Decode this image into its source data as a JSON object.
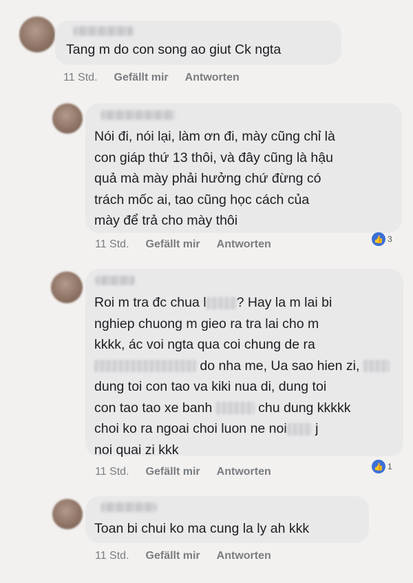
{
  "comments": [
    {
      "text": "Tang m do con song ao giut Ck ngta",
      "time": "11 Std.",
      "like": "Gefällt mir",
      "reply": "Antworten"
    },
    {
      "text": "Nói đi, nói lại, làm ơn đi, mày cũng chỉ là\ncon giáp thứ 13 thôi, và đây cũng là hậu\nquả mà mày phải hưởng chứ đừng có\ntrách mốc ai, tao cũng học cách của\nmày để trả cho mày thôi",
      "time": "11 Std.",
      "like": "Gefällt mir",
      "reply": "Antworten",
      "reaction_count": "3"
    },
    {
      "line1a": "Roi m tra đc chua l",
      "line1b": "? Hay la m lai bi",
      "line2": "nghiep chuong m gieo ra tra lai cho m",
      "line3": "kkkk, ác voi ngta qua coi chung de ra",
      "line4": "do nha me, Ua sao hien zi,",
      "line5": "dung toi con tao va kiki nua di, dung toi",
      "line6a": "con tao tao xe banh",
      "line6b": "chu dung kkkkk",
      "line7a": "choi ko ra ngoai choi luon ne noi",
      "line7b": "j",
      "line8": "noi quai zi kkk",
      "time": "11 Std.",
      "like": "Gefällt mir",
      "reply": "Antworten",
      "reaction_count": "1"
    },
    {
      "text": "Toan bi chui ko ma cung la ly ah kkk",
      "time": "11 Std.",
      "like": "Gefällt mir",
      "reply": "Antworten"
    }
  ],
  "colors": {
    "background": "#f2f1ef",
    "bubble": "#e9e9ea",
    "text": "#1c1e21",
    "meta": "#7b7d82",
    "like_blue": "#3b6fd6"
  },
  "icons": [
    "avatar",
    "thumbs-up-icon"
  ]
}
